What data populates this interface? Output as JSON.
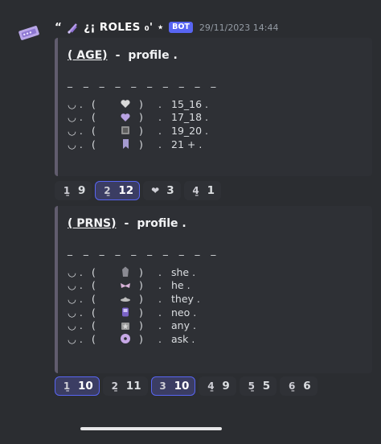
{
  "message": {
    "author_prefix": "“",
    "author_name": "¿¡ ROLES ₀' ⋆",
    "bot_badge": "BOT",
    "timestamp": "29/11/2023 14:44"
  },
  "embeds": [
    {
      "title_tag": "( AGE)",
      "title_dash": "-",
      "title_rest": "profile .",
      "divider": "_ _ _ _ _ _ _ _ _ _",
      "rows": [
        {
          "lead": "◡ .",
          "open": "(",
          "icon": "glass-heart-icon",
          "color": "#d9d9d9",
          "close": ")",
          "dot": ".",
          "label": "15_16 ."
        },
        {
          "lead": "◡ .",
          "open": "(",
          "icon": "purple-heart-icon",
          "color": "#b9a3e3",
          "close": ")",
          "dot": ".",
          "label": "17_18 ."
        },
        {
          "lead": "◡ .",
          "open": "(",
          "icon": "frame-icon",
          "color": "#8f8f8f",
          "close": ")",
          "dot": ".",
          "label": "19_20 ."
        },
        {
          "lead": "◡ .",
          "open": "(",
          "icon": "bookmark-icon",
          "color": "#a59bd0",
          "close": ")",
          "dot": ".",
          "label": "21 + ."
        }
      ]
    },
    {
      "title_tag": "( PRNS)",
      "title_dash": "-",
      "title_rest": "profile .",
      "divider": "_ _ _ _ _ _ _ _ _ _",
      "rows": [
        {
          "lead": "◡ .",
          "open": "(",
          "icon": "crystal-icon",
          "color": "#8a8a92",
          "close": ")",
          "dot": ".",
          "label": "she ."
        },
        {
          "lead": "◡ .",
          "open": "(",
          "icon": "ribbon-icon",
          "color": "#d9b3d9",
          "close": ")",
          "dot": ".",
          "label": "he ."
        },
        {
          "lead": "◡ .",
          "open": "(",
          "icon": "hat-icon",
          "color": "#bdbdbd",
          "close": ")",
          "dot": ".",
          "label": "they ."
        },
        {
          "lead": "◡ .",
          "open": "(",
          "icon": "device-icon",
          "color": "#7a62c7",
          "close": ")",
          "dot": ".",
          "label": "neo ."
        },
        {
          "lead": "◡ .",
          "open": "(",
          "icon": "star-box-icon",
          "color": "#9a9a9a",
          "close": ")",
          "dot": ".",
          "label": "any ."
        },
        {
          "lead": "◡ .",
          "open": "(",
          "icon": "disc-icon",
          "color": "#c7a8e6",
          "close": ")",
          "dot": ".",
          "label": "ask ."
        }
      ]
    }
  ],
  "reactions_age": [
    {
      "emoji": "1̱",
      "count": "9",
      "selected": false
    },
    {
      "emoji": "2̱",
      "count": "12",
      "selected": true
    },
    {
      "emoji": "❤",
      "count": "3",
      "selected": false
    },
    {
      "emoji": "4̱",
      "count": "1",
      "selected": false
    }
  ],
  "reactions_prns": [
    {
      "emoji": "1̱",
      "count": "10",
      "selected": true
    },
    {
      "emoji": "2̱",
      "count": "11",
      "selected": false
    },
    {
      "emoji": "3",
      "count": "10",
      "selected": true
    },
    {
      "emoji": "4̱",
      "count": "9",
      "selected": false
    },
    {
      "emoji": "5̱",
      "count": "5",
      "selected": false
    },
    {
      "emoji": "6̱",
      "count": "6",
      "selected": false
    }
  ]
}
